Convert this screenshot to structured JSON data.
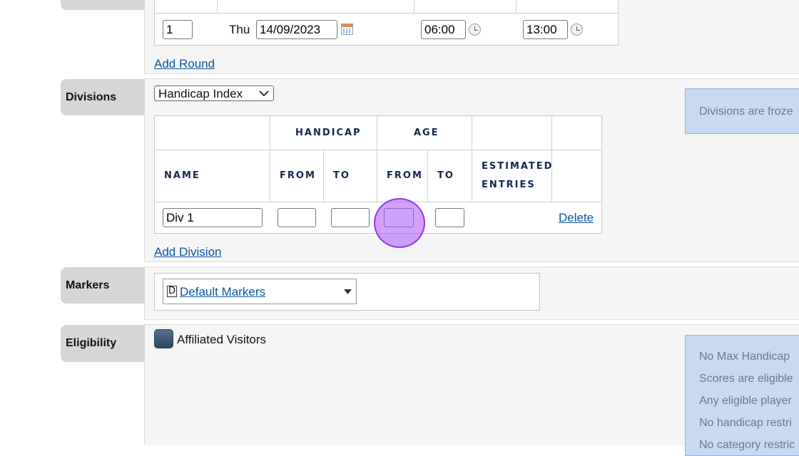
{
  "rounds": {
    "row": {
      "number": "1",
      "day": "Thu",
      "date": "14/09/2023",
      "start_time": "06:00",
      "end_time": "13:00"
    },
    "add_round": "Add Round"
  },
  "divisions": {
    "label": "Divisions",
    "select_value": "Handicap Index",
    "headers": {
      "handicap": "HANDICAP",
      "age": "AGE",
      "name": "NAME",
      "from": "FROM",
      "to": "TO",
      "estimated": "ESTIMATED",
      "entries": "ENTRIES"
    },
    "row": {
      "name": "Div 1",
      "handicap_from": "",
      "handicap_to": "",
      "age_from": "",
      "age_to": "",
      "delete": "Delete"
    },
    "add_division": "Add Division",
    "info": "Divisions are froze"
  },
  "markers": {
    "label": "Markers",
    "badge": "D",
    "value": "Default Markers"
  },
  "eligibility": {
    "label": "Eligibility",
    "checkbox_label": "Affiliated Visitors",
    "info_lines": [
      "No Max Handicap",
      "Scores are eligible",
      "Any eligible player",
      "No handicap restri",
      "No category restric"
    ]
  },
  "colors": {
    "accent_link": "#0b56a4",
    "info_bg": "#c8d9f3",
    "highlight": "#a855f7"
  }
}
